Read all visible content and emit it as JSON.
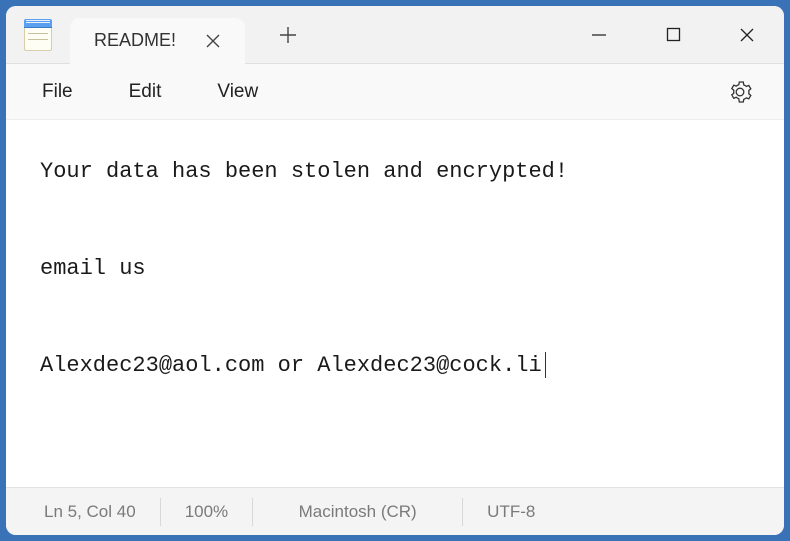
{
  "tab": {
    "title": "README!"
  },
  "menu": {
    "file": "File",
    "edit": "Edit",
    "view": "View"
  },
  "content": {
    "line1": "Your data has been stolen and encrypted!",
    "line2": "",
    "line3": "email us",
    "line4": "",
    "line5": "Alexdec23@aol.com or Alexdec23@cock.li"
  },
  "status": {
    "position": "Ln 5, Col 40",
    "zoom": "100%",
    "eol": "Macintosh (CR)",
    "encoding": "UTF-8"
  }
}
